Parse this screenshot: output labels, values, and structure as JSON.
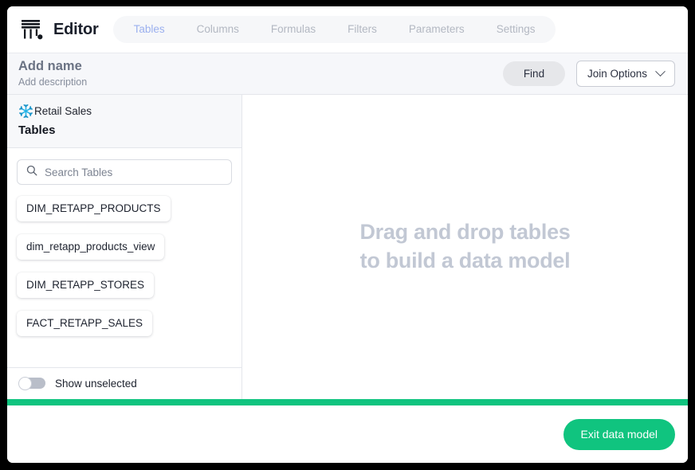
{
  "window": {
    "frame_color": "#000000",
    "accent_green": "#10c47f",
    "accent_blue": "#9bb0ef",
    "snowflake_blue": "#29b5e8"
  },
  "topbar": {
    "logo_icon": "editor-column-logo-icon",
    "title": "Editor",
    "tabs": [
      {
        "label": "Tables",
        "active": true
      },
      {
        "label": "Columns",
        "active": false
      },
      {
        "label": "Formulas",
        "active": false
      },
      {
        "label": "Filters",
        "active": false
      },
      {
        "label": "Parameters",
        "active": false
      },
      {
        "label": "Settings",
        "active": false
      }
    ]
  },
  "subheader": {
    "name_placeholder": "Add name",
    "description_placeholder": "Add description",
    "find_label": "Find",
    "join_options_label": "Join Options",
    "join_options_icon": "chevron-down-icon"
  },
  "sidebar": {
    "source_icon": "snowflake-icon",
    "source_name": "Retail Sales",
    "subtitle": "Tables",
    "search": {
      "icon": "search-icon",
      "placeholder": "Search Tables",
      "value": ""
    },
    "tables": [
      {
        "name": "DIM_RETAPP_PRODUCTS"
      },
      {
        "name": "dim_retapp_products_view"
      },
      {
        "name": "DIM_RETAPP_STORES"
      },
      {
        "name": "FACT_RETAPP_SALES"
      }
    ],
    "toggle": {
      "label": "Show unselected",
      "state": "off"
    }
  },
  "canvas": {
    "hint_line_1": "Drag and drop tables",
    "hint_line_2": "to build a data model"
  },
  "footer": {
    "exit_label": "Exit data model"
  }
}
